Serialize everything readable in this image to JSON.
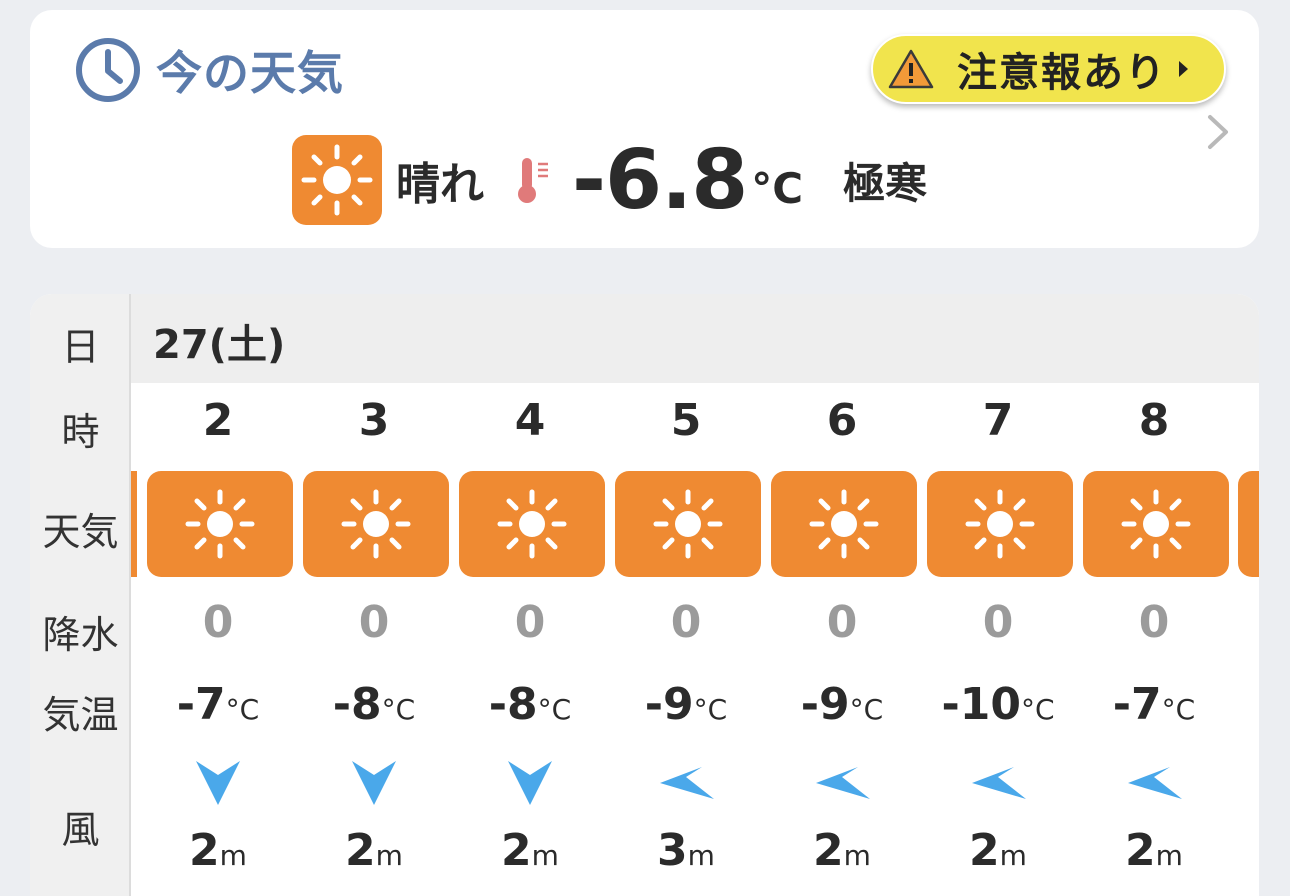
{
  "now": {
    "title": "今の天気",
    "warning_label": "注意報あり",
    "condition": "晴れ",
    "temperature": "-6.8",
    "unit": "°C",
    "feel": "極寒"
  },
  "forecast": {
    "date": "27(土)",
    "labels": {
      "day": "日",
      "hour": "時",
      "weather": "天気",
      "precip": "降水",
      "temp": "気温",
      "wind": "風"
    },
    "temp_unit": "°C",
    "wind_unit": "m",
    "hours": [
      {
        "hour": "2",
        "precip": "0",
        "temp": "-7",
        "wind": "2",
        "wind_dir": "N"
      },
      {
        "hour": "3",
        "precip": "0",
        "temp": "-8",
        "wind": "2",
        "wind_dir": "N"
      },
      {
        "hour": "4",
        "precip": "0",
        "temp": "-8",
        "wind": "2",
        "wind_dir": "N"
      },
      {
        "hour": "5",
        "precip": "0",
        "temp": "-9",
        "wind": "3",
        "wind_dir": "NW"
      },
      {
        "hour": "6",
        "precip": "0",
        "temp": "-9",
        "wind": "2",
        "wind_dir": "NW"
      },
      {
        "hour": "7",
        "precip": "0",
        "temp": "-10",
        "wind": "2",
        "wind_dir": "NW"
      },
      {
        "hour": "8",
        "precip": "0",
        "temp": "-7",
        "wind": "2",
        "wind_dir": "NW"
      }
    ]
  },
  "icons": {
    "clock": "clock-icon",
    "warning": "warning-triangle-icon",
    "chevron": "chevron-right-icon",
    "sun": "sun-icon",
    "thermometer": "thermometer-icon",
    "wind": "wind-direction-arrow-icon"
  },
  "colors": {
    "accent": "#5b7bab",
    "sun_tile": "#ef8a32",
    "warning_bg": "#f1e44d",
    "wind_arrow": "#4aa8ea",
    "precip_text": "#9b9b9b"
  }
}
